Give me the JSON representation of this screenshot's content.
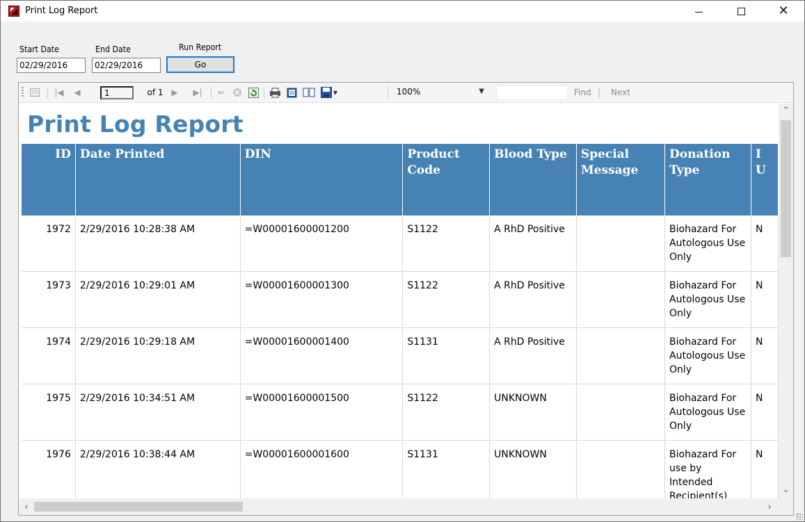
{
  "window": {
    "title": "Print Log Report"
  },
  "params": {
    "start_label": "Start Date",
    "start_value": "02/29/2016",
    "end_label": "End Date",
    "end_value": "02/29/2016",
    "run_label": "Run Report",
    "go_label": "Go"
  },
  "toolbar": {
    "page_value": "1",
    "of_text": "of 1",
    "zoom_value": "100%",
    "find_label": "Find",
    "separator": "|",
    "next_label": "Next"
  },
  "report": {
    "title": "Print Log Report",
    "header_color": "#4682b4",
    "columns": [
      "ID",
      "Date Printed",
      "DIN",
      "Product Code",
      "Blood Type",
      "Special Message",
      "Donation Type",
      "I U"
    ],
    "rows": [
      {
        "id": "1972",
        "date": "2/29/2016 10:28:38 AM",
        "din": "=W00001600001200",
        "product": "S1122",
        "blood": "A RhD Positive",
        "special": "",
        "donation": "Biohazard For Autologous Use Only",
        "extra": "N"
      },
      {
        "id": "1973",
        "date": "2/29/2016 10:29:01 AM",
        "din": "=W00001600001300",
        "product": "S1122",
        "blood": "A RhD Positive",
        "special": "",
        "donation": "Biohazard For Autologous Use Only",
        "extra": "N"
      },
      {
        "id": "1974",
        "date": "2/29/2016 10:29:18 AM",
        "din": "=W00001600001400",
        "product": "S1131",
        "blood": "A RhD Positive",
        "special": "",
        "donation": "Biohazard For Autologous Use Only",
        "extra": "N"
      },
      {
        "id": "1975",
        "date": "2/29/2016 10:34:51 AM",
        "din": "=W00001600001500",
        "product": "S1122",
        "blood": "UNKNOWN",
        "special": "",
        "donation": "Biohazard For Autologous Use Only",
        "extra": "N"
      },
      {
        "id": "1976",
        "date": "2/29/2016 10:38:44 AM",
        "din": "=W00001600001600",
        "product": "S1131",
        "blood": "UNKNOWN",
        "special": "",
        "donation": "Biohazard For use by Intended Recipient(s) Only",
        "extra": "N"
      }
    ]
  }
}
